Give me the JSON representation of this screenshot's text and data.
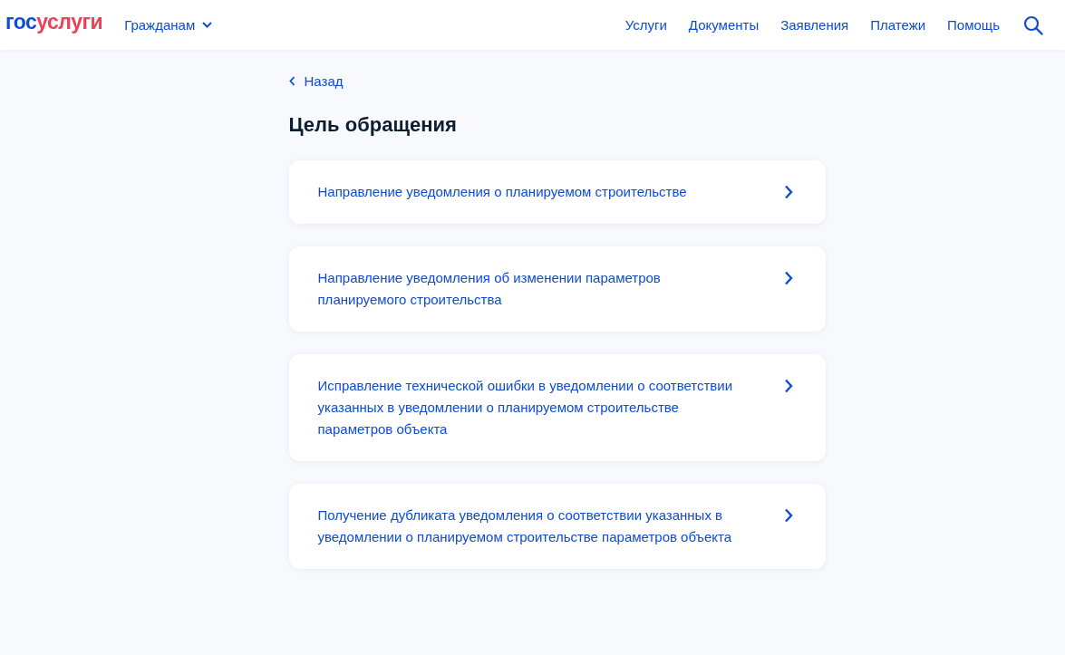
{
  "header": {
    "logo": {
      "prefix": "гос",
      "suffix": "услуги"
    },
    "audience_menu": "Гражданам",
    "nav": [
      "Услуги",
      "Документы",
      "Заявления",
      "Платежи",
      "Помощь"
    ]
  },
  "back_link": "Назад",
  "title": "Цель обращения",
  "options": [
    {
      "label": "Направление уведомления о планируемом строительстве"
    },
    {
      "label": "Направление уведомления об изменении параметров планируемого строительства"
    },
    {
      "label": "Исправление технической ошибки в уведомлении о соответствии указанных в уведомлении о планируемом строительстве параметров объекта"
    },
    {
      "label": "Получение дубликата уведомления о соответствии указанных в уведомлении о планируемом строительстве параметров объекта"
    }
  ]
}
